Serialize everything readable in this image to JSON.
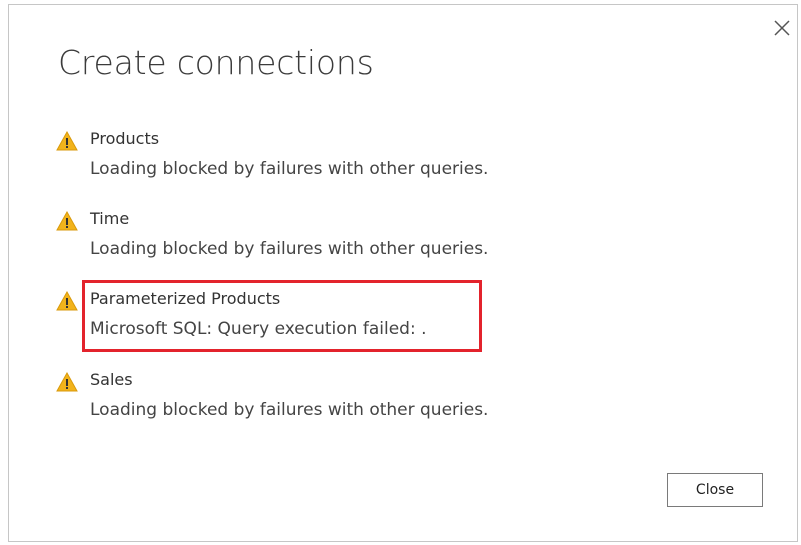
{
  "dialog": {
    "title": "Create connections",
    "close_icon": "close-icon",
    "close_button_label": "Close"
  },
  "items": [
    {
      "name": "Products",
      "message": "Loading blocked by failures with other queries.",
      "icon": "warning-icon"
    },
    {
      "name": "Time",
      "message": "Loading blocked by failures with other queries.",
      "icon": "warning-icon"
    },
    {
      "name": "Parameterized Products",
      "message": "Microsoft SQL: Query execution failed: .",
      "icon": "warning-icon",
      "highlighted": true
    },
    {
      "name": "Sales",
      "message": "Loading blocked by failures with other queries.",
      "icon": "warning-icon"
    }
  ],
  "colors": {
    "warning_fill": "#f2b31b",
    "highlight_border": "#e3232c",
    "title_text": "#3b3b3b"
  }
}
